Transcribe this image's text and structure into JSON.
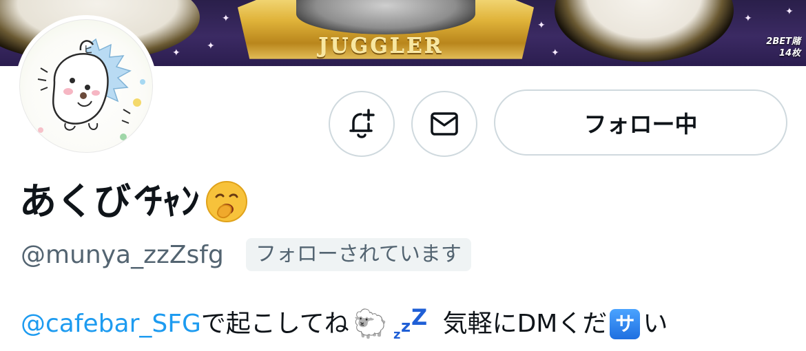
{
  "banner": {
    "plate_text": "JUGGLER",
    "bet_text": "2BET賭 14枚"
  },
  "actions": {
    "notify_icon": "bell-plus-icon",
    "message_icon": "mail-icon",
    "follow_label": "フォロー中"
  },
  "profile": {
    "display_name": "あくび́ ﾁｬﾝ",
    "name_emoji": "yawning-face-emoji",
    "handle": "@munya_zzZsfg",
    "follows_you": "フォローされています"
  },
  "bio": {
    "mention": "@cafebar_SFG",
    "text1": "で起こしてね",
    "sheep": "🐑",
    "zzz": "zzZ",
    "text2": "気軽にDMくだ",
    "sa": "サ",
    "text3": "い"
  },
  "colors": {
    "mention": "#1d9bf0",
    "secondary_text": "#536471",
    "border": "#cfd9de"
  }
}
